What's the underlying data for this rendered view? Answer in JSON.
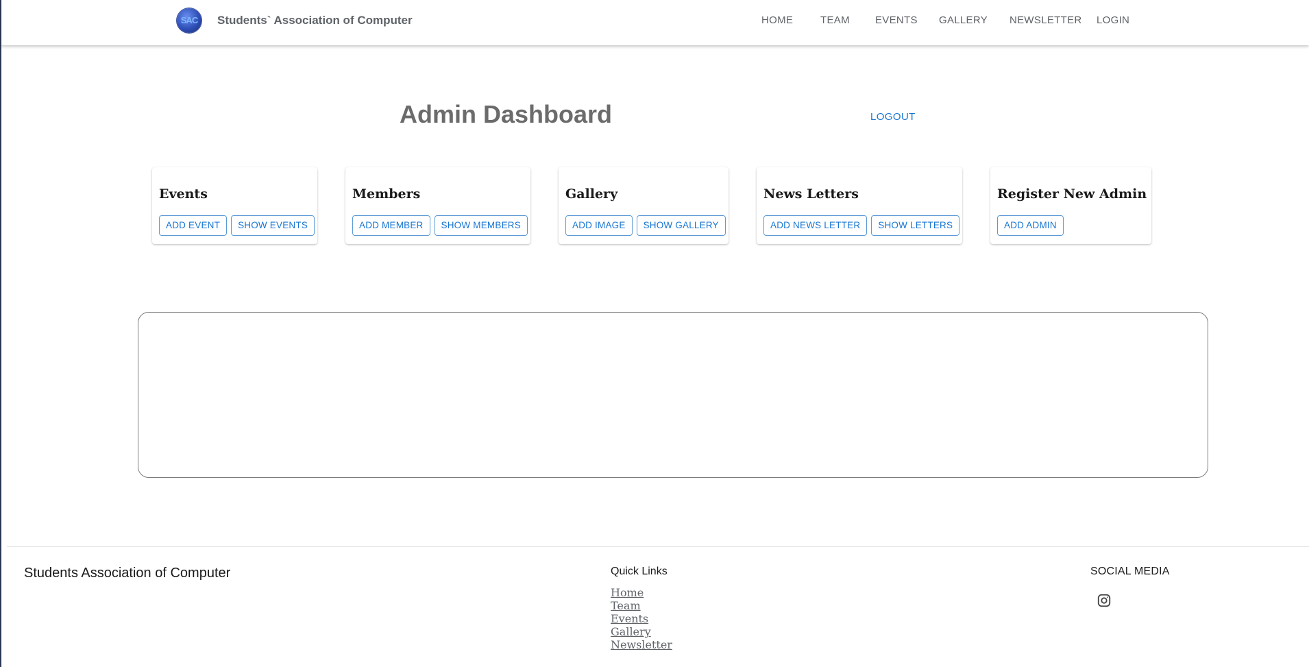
{
  "navbar": {
    "brand_logo_text": "SAC",
    "brand_name": "Students` Association of Computer",
    "links": [
      "HOME",
      "TEAM",
      "EVENTS",
      "GALLERY",
      "NEWSLETTER",
      "LOGIN"
    ]
  },
  "dashboard": {
    "title": "Admin Dashboard",
    "logout_label": "LOGOUT"
  },
  "cards": [
    {
      "title": "Events",
      "buttons": [
        "ADD EVENT",
        "SHOW EVENTS"
      ]
    },
    {
      "title": "Members",
      "buttons": [
        "ADD MEMBER",
        "SHOW MEMBERS"
      ]
    },
    {
      "title": "Gallery",
      "buttons": [
        "ADD IMAGE",
        "SHOW GALLERY"
      ]
    },
    {
      "title": "News Letters",
      "buttons": [
        "ADD NEWS LETTER",
        "SHOW LETTERS"
      ]
    },
    {
      "title": "Register New Admin",
      "buttons": [
        "ADD ADMIN"
      ]
    }
  ],
  "footer": {
    "brand": "Students Association of Computer",
    "quick_links_heading": "Quick Links",
    "quick_links": [
      "Home",
      "Team",
      "Events",
      "Gallery",
      "Newsletter"
    ],
    "social_heading": "SOCIAL MEDIA",
    "social_icons": [
      "instagram-icon"
    ]
  },
  "colors": {
    "accent": "#1976d2",
    "nav_text": "#5f6368",
    "title_gray": "#6b6b6b"
  }
}
